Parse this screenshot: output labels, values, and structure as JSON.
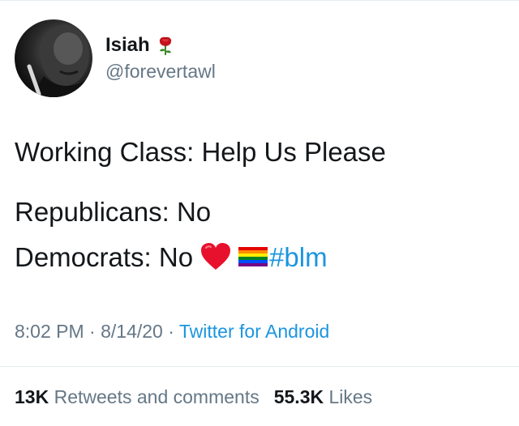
{
  "user": {
    "display_name": "Isiah",
    "handle": "@forevertawl",
    "name_emoji": "rose-icon"
  },
  "tweet": {
    "line1": "Working Class: Help Us Please",
    "line2": "Republicans: No",
    "line3_text": "Democrats: No",
    "line3_emojis": [
      "red-heart-icon",
      "rainbow-flag-icon"
    ],
    "hashtag": "#blm"
  },
  "meta": {
    "time": "8:02 PM",
    "separator1": "·",
    "date": "8/14/20",
    "separator2": "·",
    "source": "Twitter for Android"
  },
  "stats": {
    "retweets_count": "13K",
    "retweets_label": "Retweets and comments",
    "likes_count": "55.3K",
    "likes_label": "Likes"
  },
  "colors": {
    "text": "#14171a",
    "secondary": "#657786",
    "link": "#1b95e0",
    "divider": "#e6ecf0"
  }
}
